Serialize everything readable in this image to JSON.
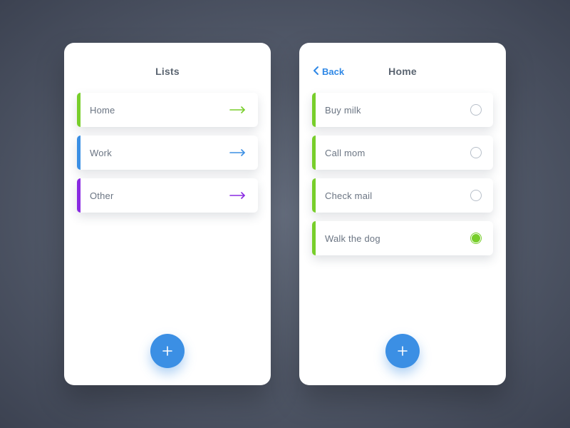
{
  "colors": {
    "accent1": "#78ce2b",
    "accent2": "#3b8fe4",
    "accent3": "#8a2be2",
    "fab": "#3b8fe4",
    "back": "#2f88e6"
  },
  "leftPanel": {
    "title": "Lists",
    "items": [
      {
        "label": "Home",
        "color": "#78ce2b"
      },
      {
        "label": "Work",
        "color": "#3b8fe4"
      },
      {
        "label": "Other",
        "color": "#8a2be2"
      }
    ]
  },
  "rightPanel": {
    "backLabel": "Back",
    "title": "Home",
    "items": [
      {
        "label": "Buy milk",
        "color": "#78ce2b",
        "checked": false
      },
      {
        "label": "Call mom",
        "color": "#78ce2b",
        "checked": false
      },
      {
        "label": "Check mail",
        "color": "#78ce2b",
        "checked": false
      },
      {
        "label": "Walk the dog",
        "color": "#78ce2b",
        "checked": true
      }
    ]
  }
}
